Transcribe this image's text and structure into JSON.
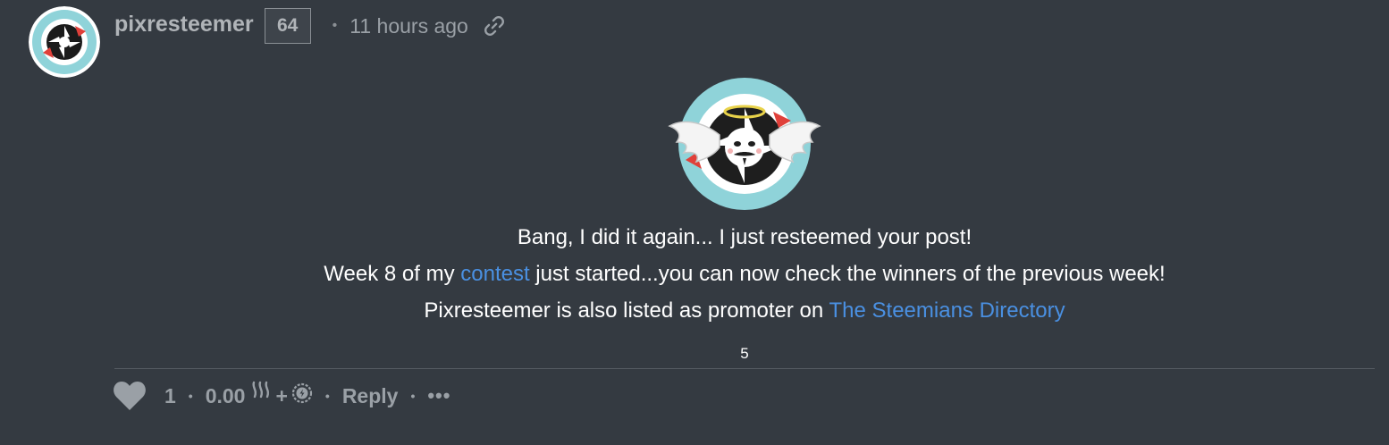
{
  "comment": {
    "author": "pixresteemer",
    "reputation": "64",
    "separator": "•",
    "time": "11 hours ago",
    "icons": {
      "avatar": "pixresteemer-avatar",
      "permalink": "link-icon",
      "post_image": "angel-mascot-image"
    },
    "body": {
      "line1": "Bang, I did it again... I just resteemed your post!",
      "line2_before": "Week 8 of my ",
      "line2_link": "contest",
      "line2_after": " just started...you can now check the winners of the previous week!",
      "line3_before": "Pixresteemer is also listed as promoter on ",
      "line3_link": "The Steemians Directory",
      "footnote": "5"
    },
    "footer": {
      "votes": "1",
      "payout": "0.00",
      "plus": "+",
      "reply": "Reply",
      "more": "•••",
      "dot": "•"
    },
    "colors": {
      "background": "#343a41",
      "link": "#4a90e2",
      "muted": "#9aa0a6",
      "text": "#ffffff",
      "avatar_ring": "#8fd3d9",
      "brand_red": "#e0403a"
    }
  }
}
